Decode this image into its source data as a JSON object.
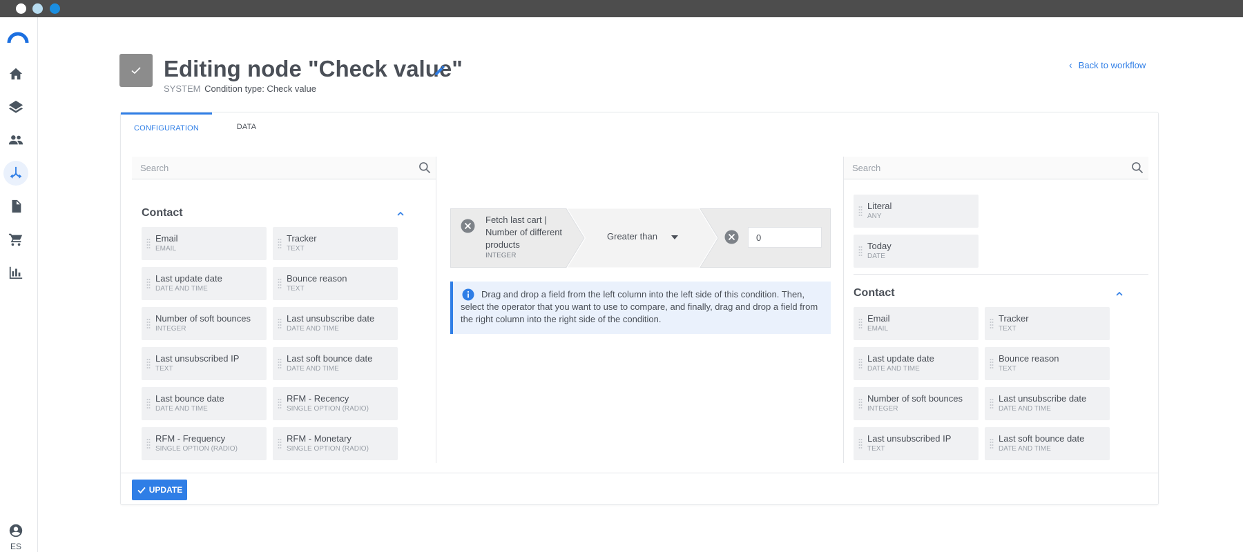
{
  "header": {
    "title": "Editing node \"Check value\"",
    "system_label": "SYSTEM",
    "condition_type": "Condition type: Check value",
    "back_link": "Back to workflow"
  },
  "sidebar": {
    "items": [
      {
        "icon": "home-icon"
      },
      {
        "icon": "layers-icon"
      },
      {
        "icon": "people-icon"
      },
      {
        "icon": "workflow-icon",
        "active": true
      },
      {
        "icon": "document-icon"
      },
      {
        "icon": "cart-icon"
      },
      {
        "icon": "chart-icon"
      }
    ],
    "language": "ES"
  },
  "tabs": [
    {
      "label": "CONFIGURATION",
      "active": true
    },
    {
      "label": "DATA",
      "active": false
    }
  ],
  "left_panel": {
    "search_placeholder": "Search",
    "section_title": "Contact",
    "fields": [
      {
        "name": "Email",
        "type": "EMAIL"
      },
      {
        "name": "Tracker",
        "type": "TEXT"
      },
      {
        "name": "Last update date",
        "type": "DATE AND TIME"
      },
      {
        "name": "Bounce reason",
        "type": "TEXT"
      },
      {
        "name": "Number of soft bounces",
        "type": "INTEGER"
      },
      {
        "name": "Last unsubscribe date",
        "type": "DATE AND TIME"
      },
      {
        "name": "Last unsubscribed IP",
        "type": "TEXT"
      },
      {
        "name": "Last soft bounce date",
        "type": "DATE AND TIME"
      },
      {
        "name": "Last bounce date",
        "type": "DATE AND TIME"
      },
      {
        "name": "RFM - Recency",
        "type": "SINGLE OPTION (RADIO)"
      },
      {
        "name": "RFM - Frequency",
        "type": "SINGLE OPTION (RADIO)"
      },
      {
        "name": "RFM - Monetary",
        "type": "SINGLE OPTION (RADIO)"
      }
    ]
  },
  "condition": {
    "left_field": "Fetch last cart | Number of different products",
    "left_type": "INTEGER",
    "operator": "Greater than",
    "value": "0"
  },
  "info_text": "Drag and drop a field from the left column into the left side of this condition. Then, select the operator that you want to use to compare, and finally, drag and drop a field from the right column into the right side of the condition.",
  "right_panel": {
    "search_placeholder": "Search",
    "special_fields": [
      {
        "name": "Literal",
        "type": "ANY"
      },
      {
        "name": "Today",
        "type": "DATE"
      }
    ],
    "section_title": "Contact",
    "fields": [
      {
        "name": "Email",
        "type": "EMAIL"
      },
      {
        "name": "Tracker",
        "type": "TEXT"
      },
      {
        "name": "Last update date",
        "type": "DATE AND TIME"
      },
      {
        "name": "Bounce reason",
        "type": "TEXT"
      },
      {
        "name": "Number of soft bounces",
        "type": "INTEGER"
      },
      {
        "name": "Last unsubscribe date",
        "type": "DATE AND TIME"
      },
      {
        "name": "Last unsubscribed IP",
        "type": "TEXT"
      },
      {
        "name": "Last soft bounce date",
        "type": "DATE AND TIME"
      }
    ]
  },
  "footer": {
    "update_label": "UPDATE"
  },
  "colors": {
    "accent": "#2f7ee6",
    "titlebar": "#4d4d4d",
    "field_bg": "#f0f1f3",
    "info_bg": "#eaf1fc"
  }
}
